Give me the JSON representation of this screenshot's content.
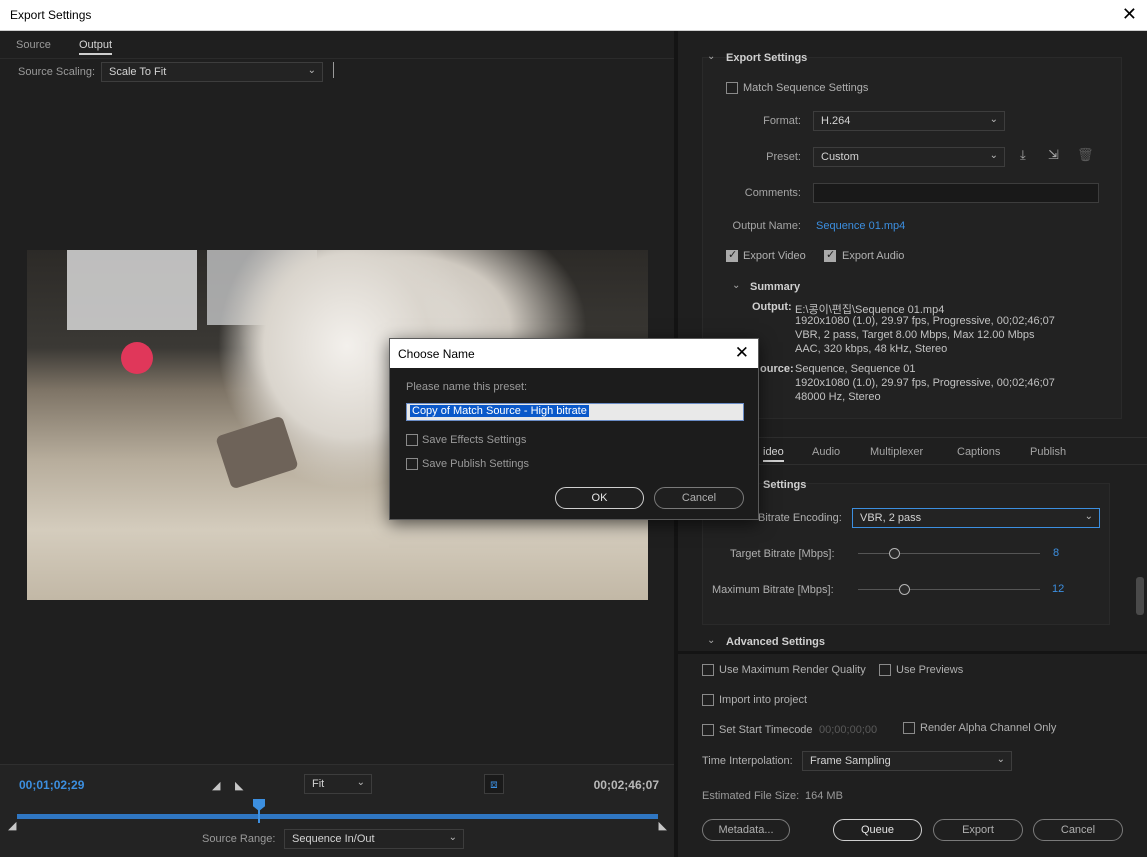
{
  "window": {
    "title": "Export Settings"
  },
  "left": {
    "tabs": [
      "Source",
      "Output"
    ],
    "source_scaling_label": "Source Scaling:",
    "source_scaling_value": "Scale To Fit",
    "timecode_in": "00;01;02;29",
    "timecode_out": "00;02;46;07",
    "zoom": "Fit",
    "source_range_label": "Source Range:",
    "source_range_value": "Sequence In/Out"
  },
  "export": {
    "section_title": "Export Settings",
    "match_sequence": "Match Sequence Settings",
    "format_label": "Format:",
    "format_value": "H.264",
    "preset_label": "Preset:",
    "preset_value": "Custom",
    "comments_label": "Comments:",
    "output_name_label": "Output Name:",
    "output_name_value": "Sequence 01.mp4",
    "export_video": "Export Video",
    "export_audio": "Export Audio",
    "summary_title": "Summary",
    "summary_output_key": "Output:",
    "summary_output": [
      "E:\\콩이\\편집\\Sequence 01.mp4",
      "1920x1080 (1.0), 29.97 fps, Progressive, 00;02;46;07",
      "VBR, 2 pass, Target 8.00 Mbps, Max 12.00 Mbps",
      "AAC, 320 kbps, 48 kHz, Stereo"
    ],
    "summary_source_key": "ource:",
    "summary_source": [
      "Sequence, Sequence 01",
      "1920x1080 (1.0), 29.97 fps, Progressive, 00;02;46;07",
      "48000 Hz, Stereo"
    ]
  },
  "vtabs": [
    "ideo",
    "Audio",
    "Multiplexer",
    "Captions",
    "Publish"
  ],
  "bitrate": {
    "section_title": "Settings",
    "encoding_label": "Bitrate Encoding:",
    "encoding_value": "VBR, 2 pass",
    "target_label": "Target Bitrate [Mbps]:",
    "target_value": "8",
    "target_fraction": 0.2,
    "max_label": "Maximum Bitrate [Mbps]:",
    "max_value": "12",
    "max_fraction": 0.25
  },
  "advanced": {
    "title": "Advanced Settings"
  },
  "bottom": {
    "max_render_quality": "Use Maximum Render Quality",
    "use_previews": "Use Previews",
    "import_into_project": "Import into project",
    "set_start_timecode": "Set Start Timecode",
    "start_timecode_value": "00;00;00;00",
    "render_alpha": "Render Alpha Channel Only",
    "time_interp_label": "Time Interpolation:",
    "time_interp_value": "Frame Sampling",
    "file_size_label": "Estimated File Size:",
    "file_size_value": "164 MB",
    "metadata_button": "Metadata...",
    "queue_button": "Queue",
    "export_button": "Export",
    "cancel_button": "Cancel"
  },
  "dialog": {
    "title": "Choose Name",
    "prompt": "Please name this preset:",
    "name_value": "Copy of Match Source - High bitrate",
    "save_effects": "Save Effects Settings",
    "save_publish": "Save Publish Settings",
    "ok": "OK",
    "cancel": "Cancel"
  },
  "colors": {
    "accent": "#3c8fe0",
    "selection": "#0a58c9",
    "background": "#1f1f1f"
  }
}
